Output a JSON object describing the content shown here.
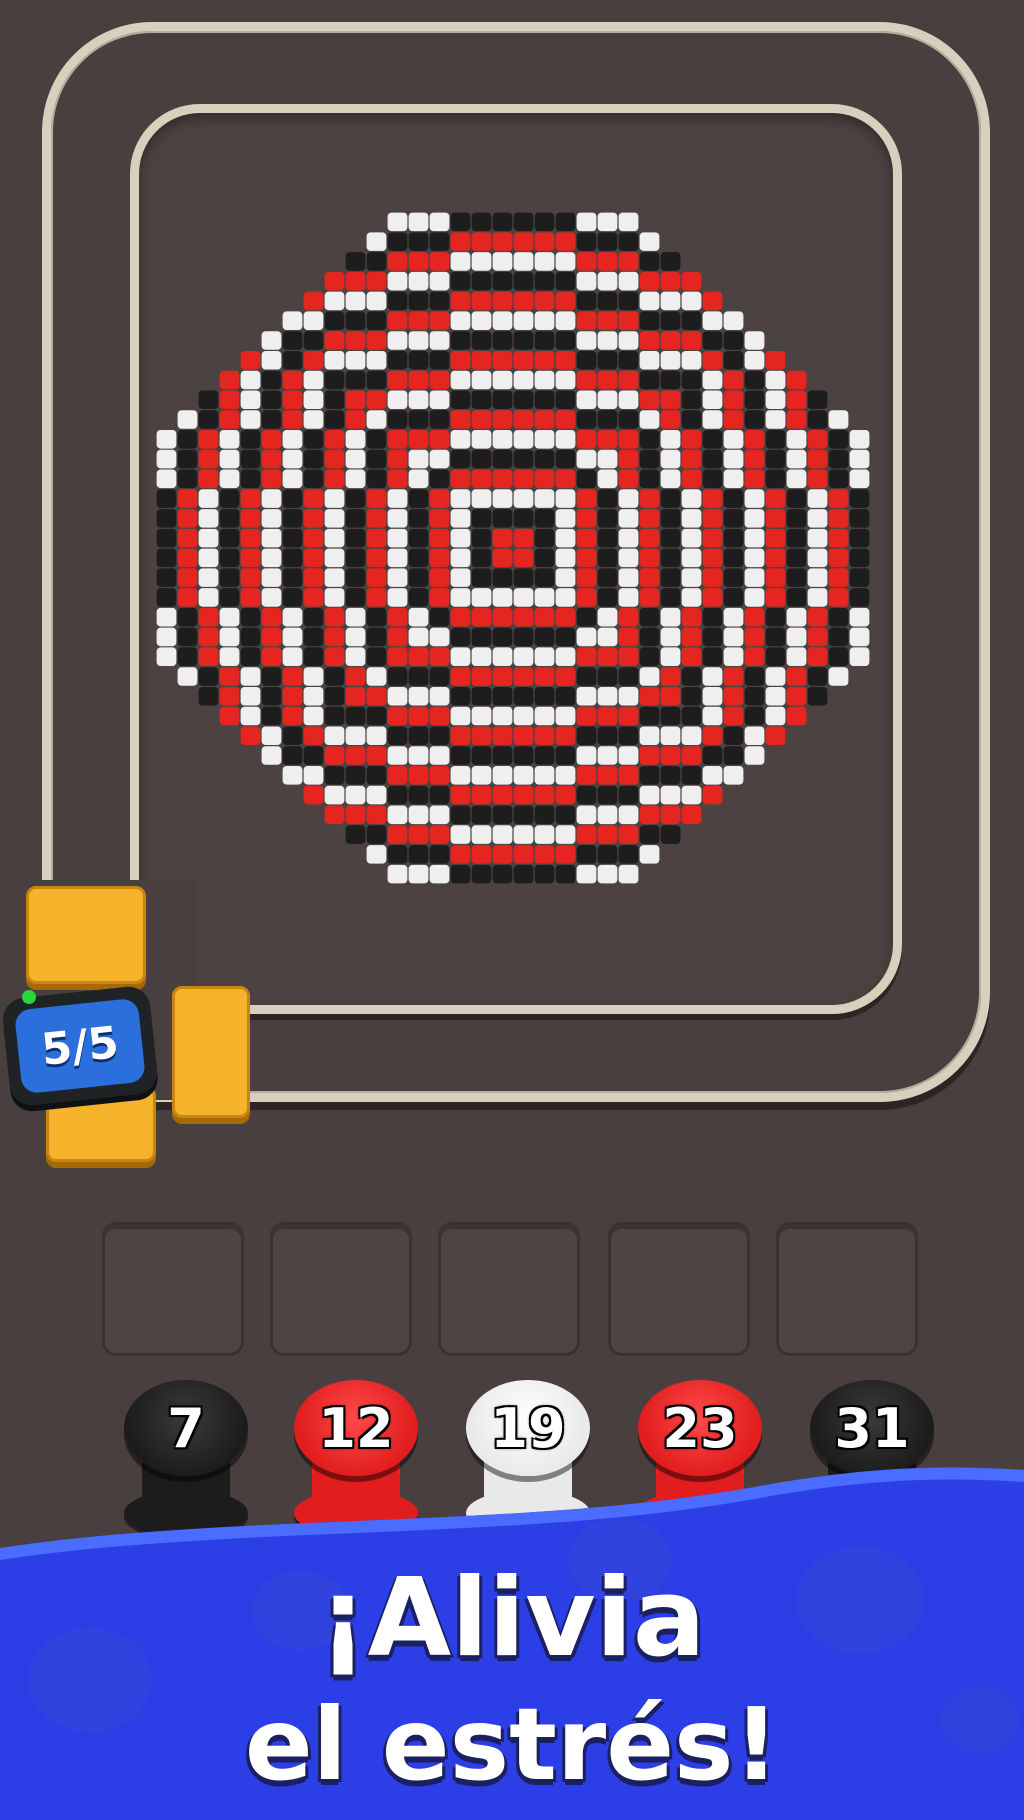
{
  "counter": {
    "value": "5/5"
  },
  "spools": [
    {
      "label": "7",
      "color": "#1c1c1c",
      "accent": "#3a3a3a"
    },
    {
      "label": "12",
      "color": "#e11d1d",
      "accent": "#ff4a4a"
    },
    {
      "label": "19",
      "color": "#e9e9e9",
      "accent": "#ffffff"
    },
    {
      "label": "23",
      "color": "#e11d1d",
      "accent": "#ff4a4a"
    },
    {
      "label": "31",
      "color": "#1c1c1c",
      "accent": "#3a3a3a"
    }
  ],
  "slots_count": 5,
  "banner": {
    "line1": "¡Alivia",
    "line2": "el estrés!",
    "color": "#2c3ee6"
  },
  "pattern_colors": {
    "red": "#e52620",
    "black": "#1d1d1d",
    "white": "#efefef"
  }
}
